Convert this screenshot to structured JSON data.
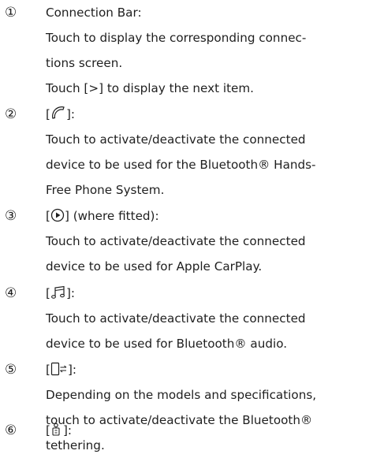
{
  "items": [
    {
      "number": "①",
      "lines": [
        "Connection Bar:",
        "Touch to display the corresponding connec-",
        "tions screen.",
        "Touch [>] to display the next item."
      ]
    },
    {
      "number": "②",
      "icon": "phone-handset-icon",
      "lines": [
        "Touch to activate/deactivate the connected",
        "device to be used for the Bluetooth® Hands-",
        "Free Phone System."
      ]
    },
    {
      "number": "③",
      "icon": "play-circle-icon",
      "heading_suffix": " (where fitted):",
      "lines": [
        "Touch to activate/deactivate the connected",
        "device to be used for Apple CarPlay."
      ]
    },
    {
      "number": "④",
      "icon": "music-note-icon",
      "lines": [
        "Touch to activate/deactivate the connected",
        "device to be used for Bluetooth® audio."
      ]
    },
    {
      "number": "⑤",
      "icon": "tethering-icon",
      "lines": [
        "Depending on the models and specifications,",
        "touch to activate/deactivate the Bluetooth®",
        "tethering."
      ]
    },
    {
      "number": "⑥",
      "icon": "person-tag-icon",
      "lines": []
    }
  ],
  "bracket_open": "[",
  "bracket_close": "]:",
  "bracket_close_plain": "]"
}
